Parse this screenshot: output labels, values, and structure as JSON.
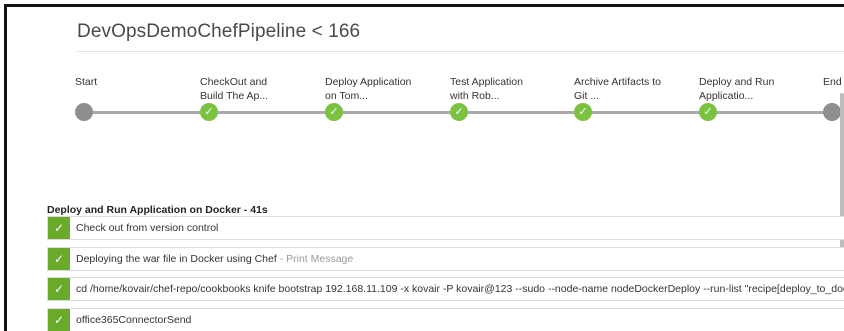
{
  "page": {
    "title": "DevOpsDemoChefPipeline < 166"
  },
  "pipeline": {
    "stages": [
      {
        "line1": "Start",
        "line2": "",
        "status": "start"
      },
      {
        "line1": "CheckOut and",
        "line2": "Build The Ap...",
        "status": "success"
      },
      {
        "line1": "Deploy Application",
        "line2": "on Tom...",
        "status": "success"
      },
      {
        "line1": "Test Application",
        "line2": "with Rob...",
        "status": "success"
      },
      {
        "line1": "Archive Artifacts to",
        "line2": "Git ...",
        "status": "success"
      },
      {
        "line1": "Deploy and Run",
        "line2": "Applicatio...",
        "status": "success"
      },
      {
        "line1": "End",
        "line2": "",
        "status": "end"
      }
    ],
    "success_glyph": "✓"
  },
  "details": {
    "section_title": "Deploy and Run Application on Docker - 41s",
    "steps": [
      {
        "text": "Check out from version control",
        "sub": ""
      },
      {
        "text": "Deploying the war file in Docker using Chef",
        "sub": " - Print Message"
      },
      {
        "text": "cd /home/kovair/chef-repo/cookbooks knife bootstrap 192.168.11.109 -x kovair -P kovair@123 --sudo --node-name nodeDockerDeploy --run-list \"recipe[deploy_to_docker",
        "sub": ""
      },
      {
        "text": "office365ConnectorSend",
        "sub": ""
      }
    ]
  },
  "colors": {
    "success": "#7cc241",
    "success_step": "#6aaa2b",
    "node_gray": "#8e8e8e",
    "track": "#a9a9a9"
  },
  "icons": {
    "success": "check-icon",
    "start_end_node": "circle-icon"
  }
}
